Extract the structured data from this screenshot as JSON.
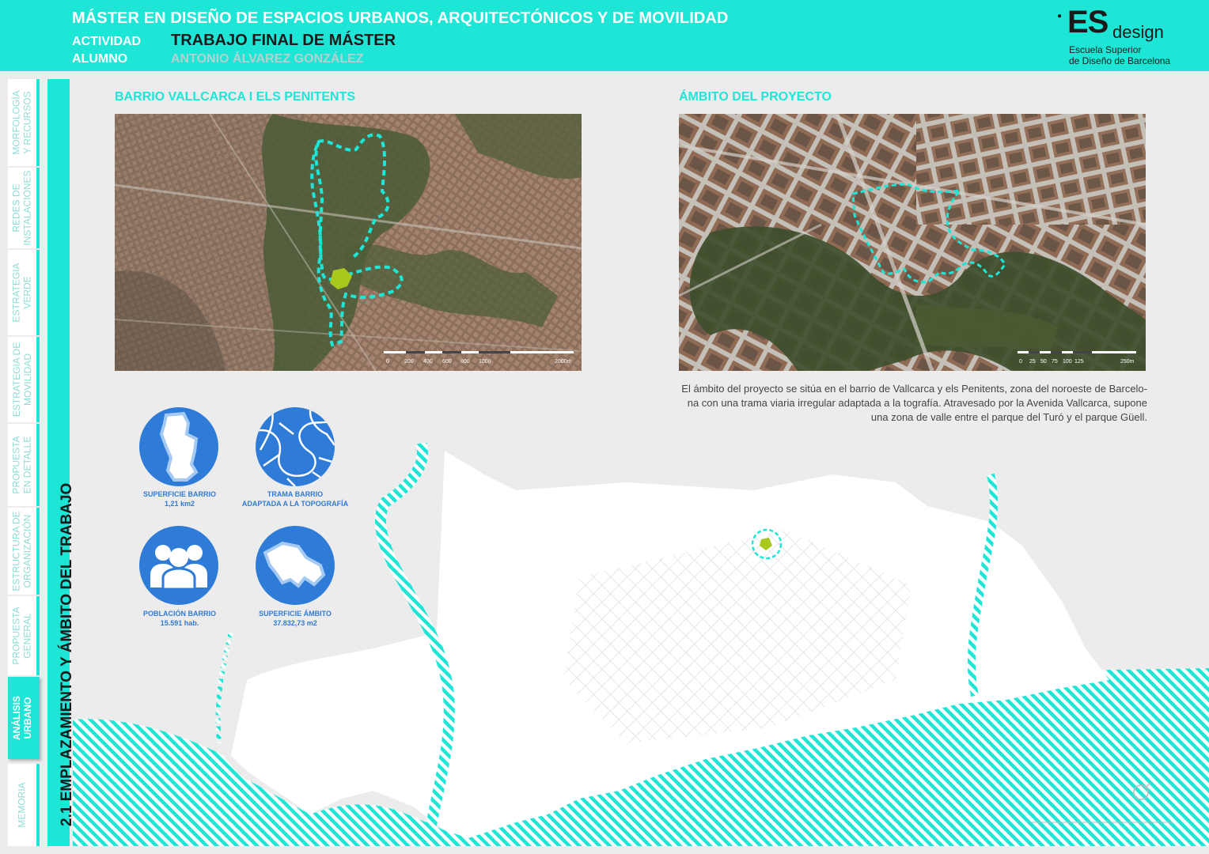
{
  "header": {
    "title": "MÁSTER EN DISEÑO DE ESPACIOS URBANOS, ARQUITECTÓNICOS Y DE MOVILIDAD",
    "actividad_label": "ACTIVIDAD",
    "actividad_value": "TRABAJO FINAL DE MÁSTER",
    "alumno_label": "ALUMNO",
    "alumno_value": "ANTONIO ÁLVAREZ GONZÁLEZ",
    "accent_color": "#1de6d6"
  },
  "logo": {
    "es": "ES",
    "design": "design",
    "line1": "Escuela Superior",
    "line2": "de Diseño de Barcelona"
  },
  "sidebar": {
    "tabs": [
      {
        "line1": "MORFOLOGÍA",
        "line2": "Y RECURSOS",
        "active": false
      },
      {
        "line1": "REDES DE",
        "line2": "INSTALACIONES",
        "active": false
      },
      {
        "line1": "ESTRATEGIA",
        "line2": "VERDE",
        "active": false
      },
      {
        "line1": "ESTRATEGIA DE",
        "line2": "MOVILIDAD",
        "active": false
      },
      {
        "line1": "PROPUESTA",
        "line2": "EN DETALLE",
        "active": false
      },
      {
        "line1": "ESTRUCTURA DE",
        "line2": "ORGANIZACIÓN",
        "active": false
      },
      {
        "line1": "PROPUESTA",
        "line2": "GENERAL",
        "active": false
      },
      {
        "line1": "ANÁLISIS",
        "line2": "URBANO",
        "active": true
      },
      {
        "line1": "MEMORIA",
        "line2": "",
        "active": false
      }
    ]
  },
  "section": {
    "title": "2.1 EMPLAZAMIENTO Y ÁMBITO DEL TRABAJO"
  },
  "map_left": {
    "title": "BARRIO VALLCARCA I ELS PENITENTS",
    "scale_labels": [
      "0",
      "200",
      "400",
      "600",
      "800",
      "1000",
      "2000m"
    ]
  },
  "map_right": {
    "title": "ÁMBITO DEL PROYECTO",
    "scale_labels": [
      "0",
      "25",
      "50",
      "75",
      "100",
      "125",
      "250m"
    ]
  },
  "description": {
    "line1": "El ámbito del proyecto se sitúa en el barrio de Vallcarca y els Penitents, zona del noroeste de Barcelo-",
    "line2": "na con una trama viaria irregular adaptada a la tografía. Atravesado por la Avenida Vallcarca, supone",
    "line3": "una zona de valle entre el parque del Turó y el parque Güell."
  },
  "stats": [
    {
      "icon": "district-shape-icon",
      "label": "SUPERFICIE BARRIO",
      "value": "1,21 km2"
    },
    {
      "icon": "street-grid-icon",
      "label": "TRAMA BARRIO",
      "value": "ADAPTADA A LA TOPOGRAFÍA"
    },
    {
      "icon": "people-icon",
      "label": "POBLACIÓN BARRIO",
      "value": "15.591 hab."
    },
    {
      "icon": "area-shape-icon",
      "label": "SUPERFICIE ÁMBITO",
      "value": "37.832,73 m2"
    }
  ]
}
